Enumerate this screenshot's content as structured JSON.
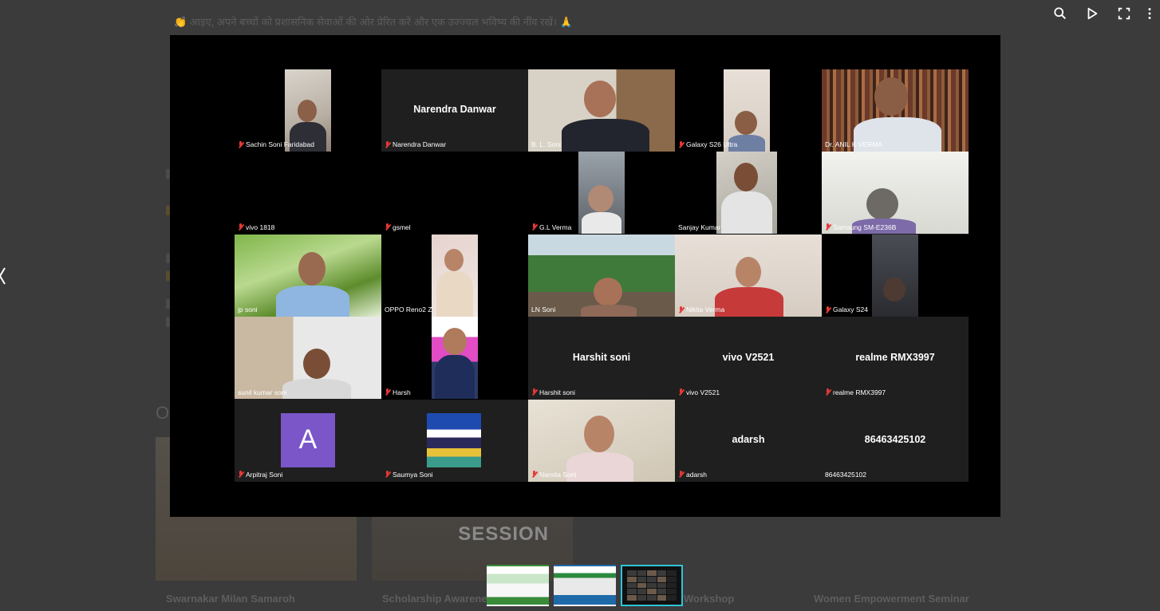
{
  "background": {
    "banner_text": "👏 आइए, अपने बच्चों को प्रशासनिक सेवाओं की ओर प्रेरित करें और एक उज्ज्वल भविष्य की नींव रखें। 🙏",
    "section_heading": "O",
    "cards": [
      {
        "title": "Swarnakar Milan Samaroh"
      },
      {
        "title": "Scholarship Awarene",
        "badge": "SESSION"
      },
      {
        "title": "Workshop"
      },
      {
        "title": "Women Empowerment Seminar"
      }
    ]
  },
  "toolbar": {
    "search": "search-icon",
    "play": "play-icon",
    "fullscreen": "fullscreen-icon"
  },
  "colors": {
    "active_speaker": "#3cb371",
    "active_thumb": "#2ec4d6",
    "muted_mic": "#e53935",
    "avatar_a": "#7b56c9"
  },
  "participants": [
    {
      "label": "Sachin Soni Faridabad",
      "muted": true
    },
    {
      "label": "Narendra Danwar",
      "center": "Narendra Danwar",
      "muted": true
    },
    {
      "label": "B. L. Soni",
      "muted": false
    },
    {
      "label": "Galaxy S26 Ultra",
      "muted": true
    },
    {
      "label": "Dr. ANIL K VERMA",
      "muted": false
    },
    {
      "label": "vivo 1818",
      "muted": true
    },
    {
      "label": "gsmel",
      "muted": true
    },
    {
      "label": "G.L Verma",
      "muted": true
    },
    {
      "label": "Sanjay Kumar",
      "muted": false
    },
    {
      "label": "Samsung SM-E236B",
      "muted": true
    },
    {
      "label": "jp soni",
      "muted": false
    },
    {
      "label": "OPPO Reno2 Z",
      "muted": false
    },
    {
      "label": "LN Soni",
      "muted": false
    },
    {
      "label": "Nikita Verma",
      "muted": true
    },
    {
      "label": "Galaxy S24",
      "muted": true
    },
    {
      "label": "sunil kumar soni",
      "muted": false
    },
    {
      "label": "Harsh",
      "muted": true
    },
    {
      "label": "Harshit soni",
      "center": "Harshit soni",
      "muted": true
    },
    {
      "label": "vivo V2521",
      "center": "vivo V2521",
      "muted": true
    },
    {
      "label": "realme RMX3997",
      "center": "realme RMX3997",
      "muted": true
    },
    {
      "label": "Arpitraj Soni",
      "avatar": "A",
      "muted": true
    },
    {
      "label": "Saumya Soni",
      "muted": true
    },
    {
      "label": "Namita Soni",
      "muted": true
    },
    {
      "label": "adarsh",
      "center": "adarsh",
      "muted": true
    },
    {
      "label": "86463425102",
      "center": "86463425102",
      "muted": false
    }
  ]
}
